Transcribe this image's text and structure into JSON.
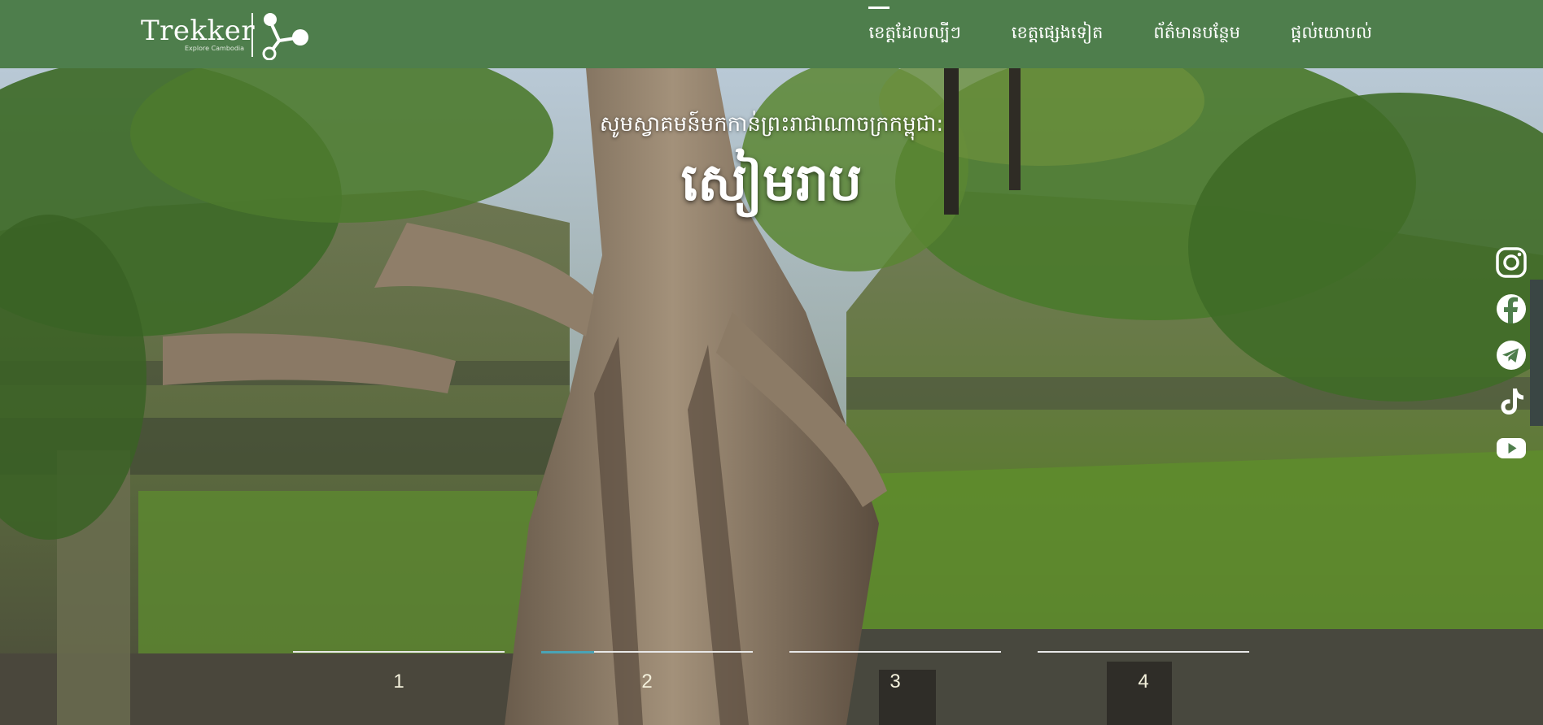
{
  "header": {
    "logo_text": "Trekker",
    "logo_tagline": "Explore Cambodia",
    "nav": [
      {
        "label": "ខេត្តដែលល្បីៗ",
        "active": true
      },
      {
        "label": "ខេត្តផ្សេងទៀត",
        "active": false
      },
      {
        "label": "ព័ត៌មានបន្ថែម",
        "active": false
      },
      {
        "label": "ផ្តល់យោបល់",
        "active": false
      }
    ]
  },
  "hero": {
    "subtitle": "សូមស្វាគមន៍មកកាន់ព្រះរាជាណាចក្រកម្ពុជា:",
    "title": "សៀមរាប"
  },
  "social": [
    "instagram-icon",
    "facebook-icon",
    "telegram-icon",
    "tiktok-icon",
    "youtube-icon"
  ],
  "slider": {
    "pages": [
      "1",
      "2",
      "3",
      "4"
    ],
    "active_index": 1,
    "active_progress": 0.25
  },
  "colors": {
    "header_bg": "#4e7e4c",
    "progress": "#4aa3b5",
    "text": "#ffffff"
  }
}
